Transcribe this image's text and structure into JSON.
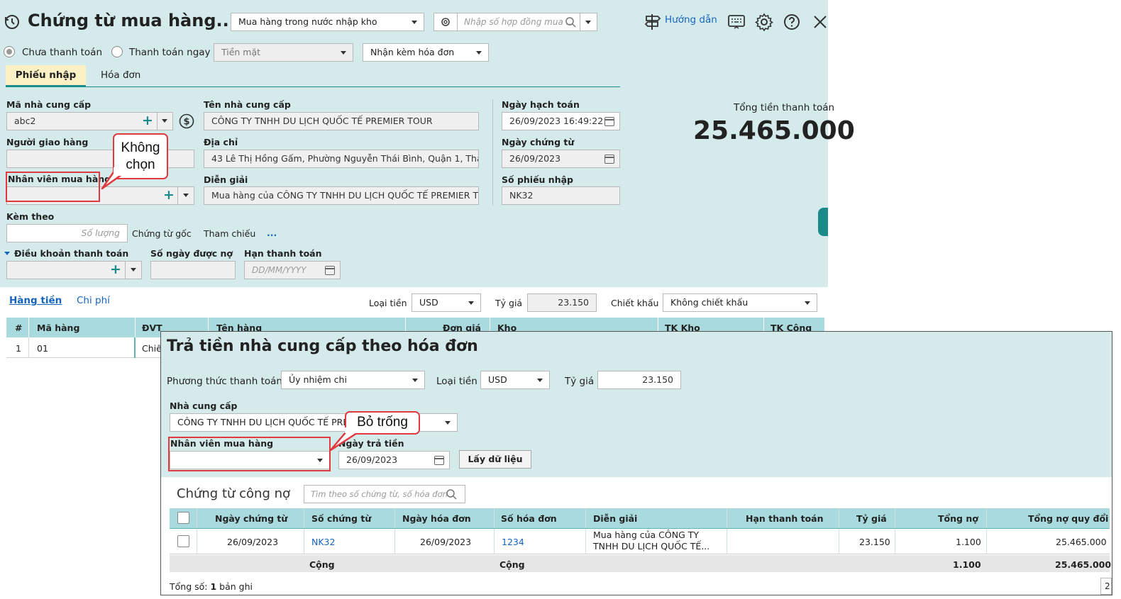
{
  "header": {
    "title": "Chứng từ mua hàng...",
    "type_select": "Mua hàng trong nước nhập kho",
    "contract_placeholder": "Nhập số hợp đồng mua ...",
    "guide_label": "Hướng dẫn"
  },
  "payment": {
    "unpaid_label": "Chưa thanh toán",
    "paid_now_label": "Thanh toán ngay",
    "method_select": "Tiền mặt",
    "invoice_select": "Nhận kèm hóa đơn"
  },
  "tabs": {
    "receipt": "Phiếu nhập",
    "invoice": "Hóa đơn"
  },
  "form": {
    "supplier_code_label": "Mã nhà cung cấp",
    "supplier_code": "abc2",
    "supplier_name_label": "Tên nhà cung cấp",
    "supplier_name": "CÔNG TY TNHH DU LỊCH QUỐC TẾ PREMIER TOUR",
    "posting_date_label": "Ngày hạch toán",
    "posting_date": "26/09/2023 16:49:22",
    "deliverer_label": "Người giao hàng",
    "address_label": "Địa chỉ",
    "address": "43 Lê Thị Hồng Gấm, Phường Nguyễn Thái Bình, Quận 1, Thà",
    "voucher_date_label": "Ngày chứng từ",
    "voucher_date": "26/09/2023",
    "buyer_label": "Nhân viên mua hàng",
    "description_label": "Diễn giải",
    "description": "Mua hàng của CÔNG TY TNHH DU LỊCH QUỐC TẾ PREMIER T",
    "receipt_no_label": "Số phiếu nhập",
    "receipt_no": "NK32",
    "attach_label": "Kèm theo",
    "qty_placeholder": "Số lượng",
    "original_doc": "Chứng từ gốc",
    "reference": "Tham chiếu",
    "more": "...",
    "payment_terms_label": "Điều khoản thanh toán",
    "debt_days_label": "Số ngày được nợ",
    "due_date_label": "Hạn thanh toán",
    "due_date_placeholder": "DD/MM/YYYY"
  },
  "total": {
    "label": "Tổng tiền thanh toán",
    "value": "25.465.000"
  },
  "callout1": {
    "line1": "Không",
    "line2": "chọn"
  },
  "lower": {
    "tab_goods": "Hàng tiền",
    "tab_cost": "Chi phí",
    "currency_label": "Loại tiền",
    "currency": "USD",
    "rate_label": "Tỷ giá",
    "rate": "23.150",
    "discount_label": "Chiết khấu",
    "discount": "Không chiết khấu",
    "columns": [
      "#",
      "Mã hàng",
      "ĐVT",
      "Tên hàng",
      "Đơn giá",
      "Kho",
      "TK Kho",
      "TK Công"
    ],
    "row": {
      "index": "1",
      "code": "01",
      "unit": "Chiế"
    }
  },
  "dialog": {
    "title": "Trả tiền nhà cung cấp theo hóa đơn",
    "method_label": "Phương thức thanh toán",
    "method": "Ủy nhiệm chi",
    "currency_label": "Loại tiền",
    "currency": "USD",
    "rate_label": "Tỷ giá",
    "rate": "23.150",
    "supplier_label": "Nhà cung cấp",
    "supplier": "CÔNG TY TNHH DU LỊCH QUỐC TẾ PRE",
    "buyer_label": "Nhân viên mua hàng",
    "pay_date_label": "Ngày trả tiền",
    "pay_date": "26/09/2023",
    "fetch_button": "Lấy dữ liệu",
    "callout": "Bỏ trống",
    "debt_section": "Chứng từ công nợ",
    "search_placeholder": "Tìm theo số chứng từ, số hóa đơn",
    "columns": [
      "Ngày chứng từ",
      "Số chứng từ",
      "Ngày hóa đơn",
      "Số hóa đơn",
      "Diễn giải",
      "Hạn thanh toán",
      "Tỷ giá",
      "Tổng nợ",
      "Tổng nợ quy đổi"
    ],
    "row": {
      "voucher_date": "26/09/2023",
      "voucher_no": "NK32",
      "invoice_date": "26/09/2023",
      "invoice_no": "1234",
      "desc_line1": "Mua hàng của CÔNG TY",
      "desc_line2": "TNHH DU LỊCH QUỐC TẾ...",
      "rate": "23.150",
      "debt": "1.100",
      "debt_converted": "25.465.000"
    },
    "sum_label": "Cộng",
    "sum_label2": "Cộng",
    "sum_debt": "1.100",
    "sum_converted": "25.465.000",
    "count_prefix": "Tổng số: ",
    "count": "1",
    "count_suffix": " bản ghi",
    "page_number": "2"
  }
}
